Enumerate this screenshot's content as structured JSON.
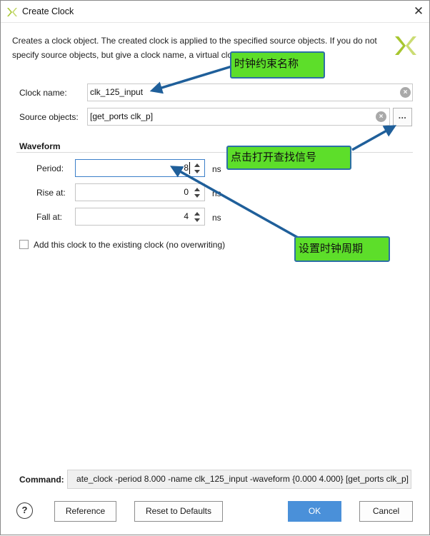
{
  "window": {
    "title": "Create Clock",
    "close_glyph": "✕"
  },
  "description": "Creates a clock object. The created clock is applied to the specified source objects. If you do not specify source objects, but give a clock name, a virtual clock will be created.",
  "clock_name": {
    "label": "Clock name:",
    "value": "clk_125_input"
  },
  "source_objects": {
    "label": "Source objects:",
    "value": "[get_ports clk_p]",
    "browse_label": "..."
  },
  "waveform": {
    "title": "Waveform",
    "period": {
      "label": "Period:",
      "value": "8",
      "unit": "ns"
    },
    "rise": {
      "label": "Rise at:",
      "value": "0",
      "unit": "ns"
    },
    "fall": {
      "label": "Fall at:",
      "value": "4",
      "unit": "ns"
    }
  },
  "add_clock_checkbox": {
    "label": "Add this clock to the existing clock (no overwriting)",
    "checked": false
  },
  "command": {
    "label": "Command:",
    "value": "ate_clock -period 8.000 -name clk_125_input -waveform {0.000 4.000} [get_ports clk_p]"
  },
  "buttons": {
    "help": "?",
    "reference": "Reference",
    "reset": "Reset to Defaults",
    "ok": "OK",
    "cancel": "Cancel"
  },
  "annotations": {
    "clock_name_note": "时钟约束名称",
    "browse_note": "点击打开查找信号",
    "period_note": "设置时钟周期"
  },
  "colors": {
    "accent": "#4a90d9",
    "annotation_bg": "#5dde2a",
    "annotation_border": "#2c6fa5",
    "xilinx_logo": "#a7c62f"
  },
  "icons": {
    "title": "xilinx-logo-icon",
    "clear": "clear-circle-icon"
  }
}
